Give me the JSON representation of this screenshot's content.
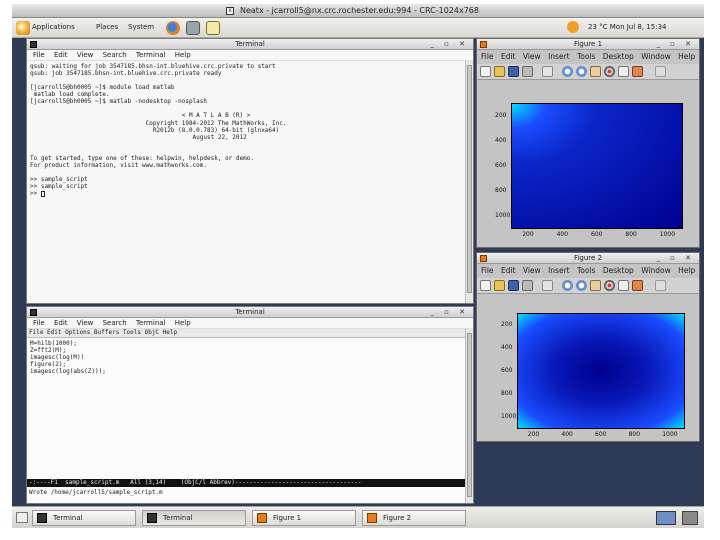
{
  "window_title": "Neatx - jcarroll5@nx.crc.rochester.edu:994 - CRC-1024x768",
  "panel": {
    "menus": [
      "Applications",
      "Places",
      "System"
    ],
    "status": "23 °C  Mon Jul 8, 15:34"
  },
  "terminal1": {
    "title": "Terminal",
    "menu": [
      "File",
      "Edit",
      "View",
      "Search",
      "Terminal",
      "Help"
    ],
    "lines": [
      "qsub: waiting for job 3547185.bhsn-int.bluehive.crc.private to start",
      "qsub: job 3547185.bhsn-int.bluehive.crc.private ready",
      "",
      "[jcarroll5@bh0005 ~]$ module load matlab",
      " matlab load complete.",
      "[jcarroll5@bh0005 ~]$ matlab -nodesktop -nosplash",
      "",
      "                                          < M A T L A B (R) >",
      "                                Copyright 1984-2012 The MathWorks, Inc.",
      "                                  R2012b (8.0.0.783) 64-bit (glnxa64)",
      "                                             August 22, 2012",
      "",
      "",
      "To get started, type one of these: helpwin, helpdesk, or demo.",
      "For product information, visit www.mathworks.com.",
      "",
      ">> sample_script",
      ">> sample_script",
      ">> "
    ]
  },
  "terminal2": {
    "title": "Terminal",
    "menu": [
      "File",
      "Edit",
      "View",
      "Search",
      "Terminal",
      "Help"
    ],
    "emacs_menu": "File Edit Options Buffers Tools ObjC Help",
    "lines": [
      "M=hilb(1000);",
      "Z=fft2(M);",
      "imagesc(log(M))",
      "figure(2);",
      "imagesc(log(abs(Z)));"
    ],
    "modeline": "-:----F1  sample_script.m   All (3,14)    (ObjC/l Abbrev)-----------------------------------",
    "minibuffer": "Wrote /home/jcarroll5/sample_script.m"
  },
  "figure1": {
    "title": "Figure 1",
    "menu": [
      "File",
      "Edit",
      "View",
      "Insert",
      "Tools",
      "Desktop",
      "Window",
      "Help"
    ],
    "yticks": [
      "200",
      "400",
      "600",
      "800",
      "1000"
    ],
    "xticks": [
      "200",
      "400",
      "600",
      "800",
      "1000"
    ]
  },
  "figure2": {
    "title": "Figure 2",
    "menu": [
      "File",
      "Edit",
      "View",
      "Insert",
      "Tools",
      "Desktop",
      "Window",
      "Help"
    ],
    "yticks": [
      "200",
      "400",
      "600",
      "800",
      "1000"
    ],
    "xticks": [
      "200",
      "400",
      "600",
      "800",
      "1000"
    ]
  },
  "taskbar": {
    "items": [
      "Terminal",
      "Terminal",
      "Figure 1",
      "Figure 2"
    ]
  },
  "colors": {
    "desktop": "#2f3b55",
    "plot_dark": "#00008f",
    "plot_light": "#1a4dff",
    "plot_edge": "#00e0ff"
  }
}
